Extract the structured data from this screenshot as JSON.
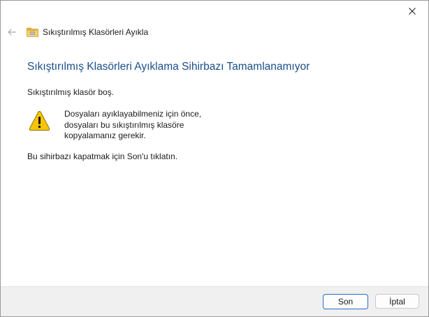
{
  "window": {
    "header_title": "Sıkıştırılmış Klasörleri Ayıkla"
  },
  "content": {
    "heading": "Sıkıştırılmış Klasörleri Ayıklama Sihirbazı Tamamlanamıyor",
    "status": "Sıkıştırılmış klasör boş.",
    "warning_lines": [
      "Dosyaları ayıklayabilmeniz için önce,",
      "dosyaları bu sıkıştırılmış klasöre",
      "kopyalamanız gerekir."
    ],
    "instruction": "Bu sihirbazı kapatmak için Son'u tıklatın."
  },
  "footer": {
    "finish_label": "Son",
    "cancel_label": "İptal"
  },
  "icons": {
    "close": "close-icon",
    "back": "back-arrow-icon",
    "folder": "zip-folder-icon",
    "warning": "warning-icon"
  },
  "colors": {
    "heading": "#1a4e8a",
    "primary_border": "#2a6bc4",
    "warning_fill": "#f7c600"
  }
}
